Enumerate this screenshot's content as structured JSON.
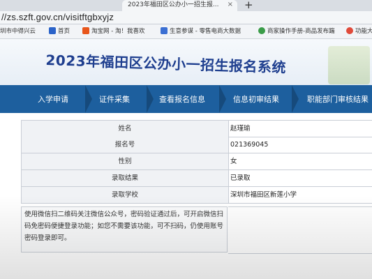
{
  "browser": {
    "tab_title": "2023年福田区公办小一招生报...",
    "tab_close": "×",
    "new_tab": "+",
    "url": "//zs.szft.gov.cn/visitftgbxyjz",
    "bookmarks": [
      {
        "label": "圳市中得兴云",
        "icon_color": "#7a8aa0"
      },
      {
        "label": "首页",
        "icon_color": "#2b63c9"
      },
      {
        "label": "淘宝网 - 淘！我喜欢",
        "icon_color": "#e8561b"
      },
      {
        "label": "生意参谋 - 零售电商大数据",
        "icon_color": "#3b6fd3"
      },
      {
        "label": "商家操作手册-商品发布踹",
        "icon_color": "#3a9c48"
      },
      {
        "label": "功能大",
        "icon_color": "#e04a3a"
      }
    ]
  },
  "page": {
    "title": "2023年福田区公办小一招生报名系统",
    "nav": [
      "入学申请",
      "证件采集",
      "查看报名信息",
      "信息初审结果",
      "职能部门审核结果"
    ],
    "fields": [
      {
        "label": "姓名",
        "value": "赵瑾瑜"
      },
      {
        "label": "报名号",
        "value": "021369045"
      },
      {
        "label": "性别",
        "value": "女"
      },
      {
        "label": "录取结果",
        "value": "已录取"
      },
      {
        "label": "录取学校",
        "value": "深圳市福田区新莲小学"
      }
    ],
    "note": "使用微信扫二维码关注微信公众号，密码验证通过后，可开启微信扫码免密码便捷登录功能；如您不需要该功能，可不扫码，仍使用账号密码登录即可。"
  }
}
